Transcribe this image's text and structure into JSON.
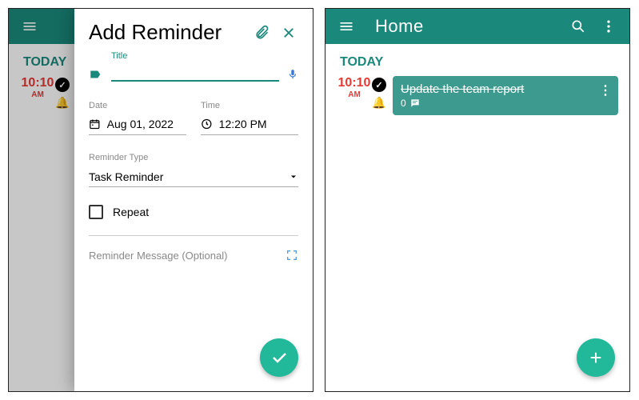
{
  "left": {
    "bg": {
      "section": "TODAY",
      "time": "10:10",
      "ampm": "AM"
    },
    "modal": {
      "title": "Add Reminder",
      "title_label": "Title",
      "title_value": "",
      "date_label": "Date",
      "date_value": "Aug 01, 2022",
      "time_label": "Time",
      "time_value": "12:20 PM",
      "type_label": "Reminder Type",
      "type_value": "Task Reminder",
      "repeat_label": "Repeat",
      "message_placeholder": "Reminder Message (Optional)"
    }
  },
  "right": {
    "appbar_title": "Home",
    "section": "TODAY",
    "time": "10:10",
    "ampm": "AM",
    "card_title": "Update the team report",
    "card_sub": "0"
  }
}
